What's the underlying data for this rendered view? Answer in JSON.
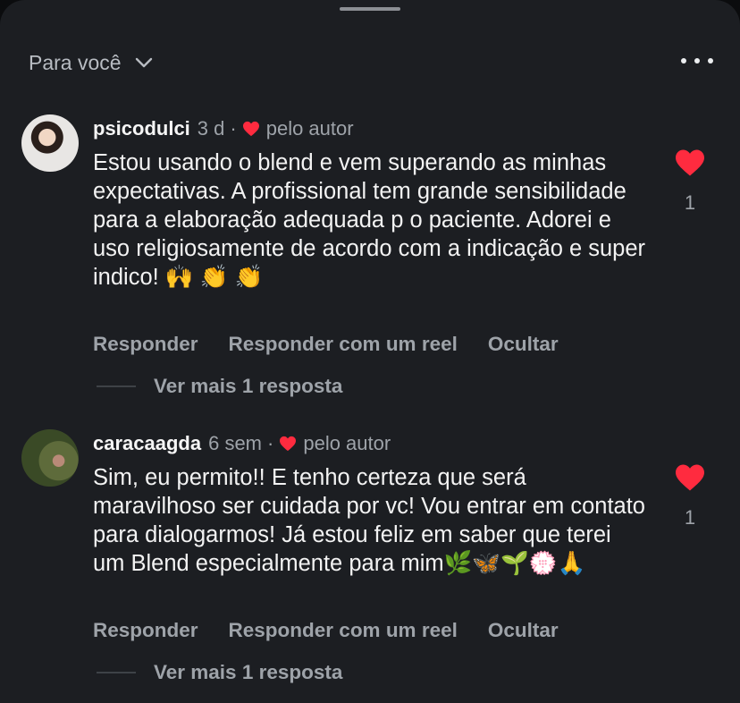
{
  "header": {
    "title": "Para você"
  },
  "colors": {
    "background": "#1c1e22",
    "heart": "#ff2b3f",
    "muted_text": "#9ea3a9"
  },
  "icons": {
    "sort": "chevron-down-icon",
    "more": "more-horizontal-icon",
    "like": "heart-icon"
  },
  "comments": [
    {
      "username": "psicodulci",
      "time": "3 d",
      "separator": "·",
      "liked_by": "pelo autor",
      "text": "Estou usando o blend e vem superando as minhas expectativas. A profissional tem grande sensibilidade para a elaboração adequada p o paciente. Adorei e uso religiosamente de acordo com a indicação e super indico! 🙌 👏 👏",
      "likes": "1",
      "actions": [
        "Responder",
        "Responder com um reel",
        "Ocultar"
      ],
      "view_more": "Ver mais 1 resposta"
    },
    {
      "username": "caracaagda",
      "time": "6 sem",
      "separator": "·",
      "liked_by": "pelo autor",
      "text": "Sim, eu permito!! E tenho certeza que será maravilhoso ser cuidada por vc! Vou entrar em contato  para dialogarmos! Já estou feliz em saber que terei um Blend especialmente para mim🌿🦋🌱💮🙏",
      "likes": "1",
      "actions": [
        "Responder",
        "Responder com um reel",
        "Ocultar"
      ],
      "view_more": "Ver mais 1 resposta"
    }
  ]
}
